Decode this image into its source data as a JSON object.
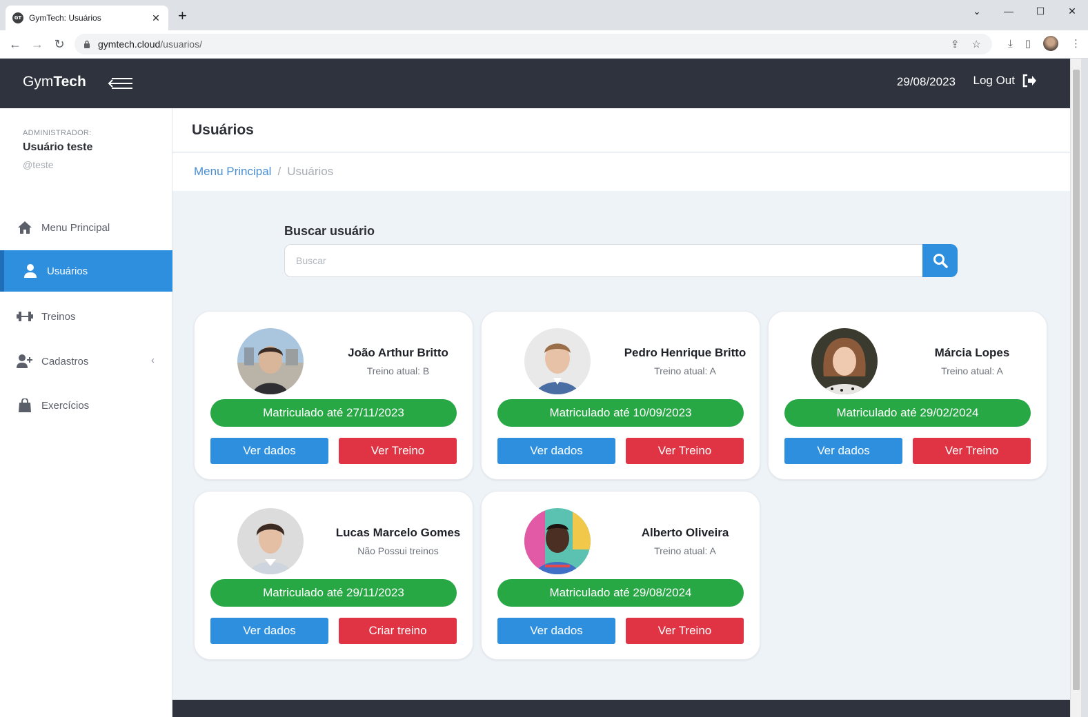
{
  "browser": {
    "tab_title": "GymTech: Usuários",
    "favicon_text": "GT",
    "url_host": "gymtech.cloud",
    "url_path": "/usuarios/"
  },
  "topnav": {
    "brand_light": "Gym",
    "brand_bold": "Tech",
    "date": "29/08/2023",
    "logout_label": "Log Out"
  },
  "sidebar": {
    "role_label": "ADMINISTRADOR:",
    "user_name": "Usuário teste",
    "user_handle": "@teste",
    "items": [
      {
        "label": "Menu Principal",
        "icon": "home-icon"
      },
      {
        "label": "Usuários",
        "icon": "user-icon",
        "active": true
      },
      {
        "label": "Treinos",
        "icon": "dumbbell-icon"
      },
      {
        "label": "Cadastros",
        "icon": "user-plus-icon",
        "has_submenu": true
      },
      {
        "label": "Exercícios",
        "icon": "bag-icon"
      }
    ]
  },
  "header": {
    "title": "Usuários"
  },
  "breadcrumb": {
    "home": "Menu Principal",
    "separator": "/",
    "current": "Usuários"
  },
  "search": {
    "label": "Buscar usuário",
    "placeholder": "Buscar"
  },
  "users": [
    {
      "name": "João Arthur Britto",
      "training": "Treino atual: B",
      "status": "Matriculado até 27/11/2023",
      "view_label": "Ver dados",
      "action_label": "Ver Treino"
    },
    {
      "name": "Pedro Henrique Britto",
      "training": "Treino atual: A",
      "status": "Matriculado até 10/09/2023",
      "view_label": "Ver dados",
      "action_label": "Ver Treino"
    },
    {
      "name": "Márcia Lopes",
      "training": "Treino atual: A",
      "status": "Matriculado até 29/02/2024",
      "view_label": "Ver dados",
      "action_label": "Ver Treino"
    },
    {
      "name": "Lucas Marcelo Gomes",
      "training": "Não Possui treinos",
      "status": "Matriculado até 29/11/2023",
      "view_label": "Ver dados",
      "action_label": "Criar treino"
    },
    {
      "name": "Alberto Oliveira",
      "training": "Treino atual: A",
      "status": "Matriculado até 29/08/2024",
      "view_label": "Ver dados",
      "action_label": "Ver Treino"
    }
  ],
  "colors": {
    "navbar": "#2e333e",
    "accent_blue": "#2e8fde",
    "status_green": "#28a745",
    "danger_red": "#e03444"
  }
}
